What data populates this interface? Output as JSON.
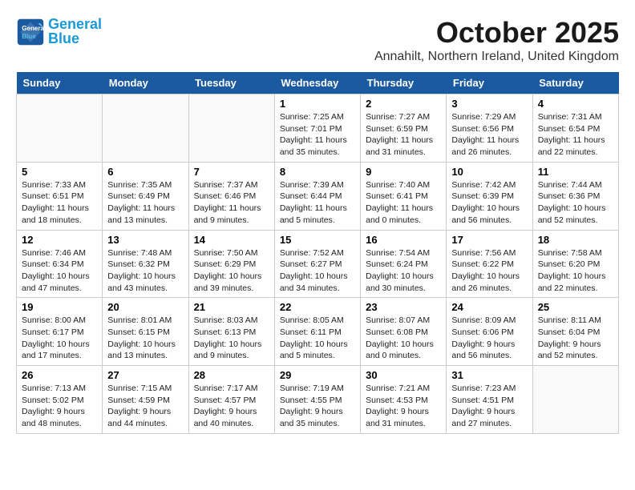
{
  "header": {
    "logo_line1": "General",
    "logo_line2": "Blue",
    "title": "October 2025",
    "subtitle": "Annahilt, Northern Ireland, United Kingdom"
  },
  "days_of_week": [
    "Sunday",
    "Monday",
    "Tuesday",
    "Wednesday",
    "Thursday",
    "Friday",
    "Saturday"
  ],
  "weeks": [
    [
      {
        "date": "",
        "content": ""
      },
      {
        "date": "",
        "content": ""
      },
      {
        "date": "",
        "content": ""
      },
      {
        "date": "1",
        "content": "Sunrise: 7:25 AM\nSunset: 7:01 PM\nDaylight: 11 hours\nand 35 minutes."
      },
      {
        "date": "2",
        "content": "Sunrise: 7:27 AM\nSunset: 6:59 PM\nDaylight: 11 hours\nand 31 minutes."
      },
      {
        "date": "3",
        "content": "Sunrise: 7:29 AM\nSunset: 6:56 PM\nDaylight: 11 hours\nand 26 minutes."
      },
      {
        "date": "4",
        "content": "Sunrise: 7:31 AM\nSunset: 6:54 PM\nDaylight: 11 hours\nand 22 minutes."
      }
    ],
    [
      {
        "date": "5",
        "content": "Sunrise: 7:33 AM\nSunset: 6:51 PM\nDaylight: 11 hours\nand 18 minutes."
      },
      {
        "date": "6",
        "content": "Sunrise: 7:35 AM\nSunset: 6:49 PM\nDaylight: 11 hours\nand 13 minutes."
      },
      {
        "date": "7",
        "content": "Sunrise: 7:37 AM\nSunset: 6:46 PM\nDaylight: 11 hours\nand 9 minutes."
      },
      {
        "date": "8",
        "content": "Sunrise: 7:39 AM\nSunset: 6:44 PM\nDaylight: 11 hours\nand 5 minutes."
      },
      {
        "date": "9",
        "content": "Sunrise: 7:40 AM\nSunset: 6:41 PM\nDaylight: 11 hours\nand 0 minutes."
      },
      {
        "date": "10",
        "content": "Sunrise: 7:42 AM\nSunset: 6:39 PM\nDaylight: 10 hours\nand 56 minutes."
      },
      {
        "date": "11",
        "content": "Sunrise: 7:44 AM\nSunset: 6:36 PM\nDaylight: 10 hours\nand 52 minutes."
      }
    ],
    [
      {
        "date": "12",
        "content": "Sunrise: 7:46 AM\nSunset: 6:34 PM\nDaylight: 10 hours\nand 47 minutes."
      },
      {
        "date": "13",
        "content": "Sunrise: 7:48 AM\nSunset: 6:32 PM\nDaylight: 10 hours\nand 43 minutes."
      },
      {
        "date": "14",
        "content": "Sunrise: 7:50 AM\nSunset: 6:29 PM\nDaylight: 10 hours\nand 39 minutes."
      },
      {
        "date": "15",
        "content": "Sunrise: 7:52 AM\nSunset: 6:27 PM\nDaylight: 10 hours\nand 34 minutes."
      },
      {
        "date": "16",
        "content": "Sunrise: 7:54 AM\nSunset: 6:24 PM\nDaylight: 10 hours\nand 30 minutes."
      },
      {
        "date": "17",
        "content": "Sunrise: 7:56 AM\nSunset: 6:22 PM\nDaylight: 10 hours\nand 26 minutes."
      },
      {
        "date": "18",
        "content": "Sunrise: 7:58 AM\nSunset: 6:20 PM\nDaylight: 10 hours\nand 22 minutes."
      }
    ],
    [
      {
        "date": "19",
        "content": "Sunrise: 8:00 AM\nSunset: 6:17 PM\nDaylight: 10 hours\nand 17 minutes."
      },
      {
        "date": "20",
        "content": "Sunrise: 8:01 AM\nSunset: 6:15 PM\nDaylight: 10 hours\nand 13 minutes."
      },
      {
        "date": "21",
        "content": "Sunrise: 8:03 AM\nSunset: 6:13 PM\nDaylight: 10 hours\nand 9 minutes."
      },
      {
        "date": "22",
        "content": "Sunrise: 8:05 AM\nSunset: 6:11 PM\nDaylight: 10 hours\nand 5 minutes."
      },
      {
        "date": "23",
        "content": "Sunrise: 8:07 AM\nSunset: 6:08 PM\nDaylight: 10 hours\nand 0 minutes."
      },
      {
        "date": "24",
        "content": "Sunrise: 8:09 AM\nSunset: 6:06 PM\nDaylight: 9 hours\nand 56 minutes."
      },
      {
        "date": "25",
        "content": "Sunrise: 8:11 AM\nSunset: 6:04 PM\nDaylight: 9 hours\nand 52 minutes."
      }
    ],
    [
      {
        "date": "26",
        "content": "Sunrise: 7:13 AM\nSunset: 5:02 PM\nDaylight: 9 hours\nand 48 minutes."
      },
      {
        "date": "27",
        "content": "Sunrise: 7:15 AM\nSunset: 4:59 PM\nDaylight: 9 hours\nand 44 minutes."
      },
      {
        "date": "28",
        "content": "Sunrise: 7:17 AM\nSunset: 4:57 PM\nDaylight: 9 hours\nand 40 minutes."
      },
      {
        "date": "29",
        "content": "Sunrise: 7:19 AM\nSunset: 4:55 PM\nDaylight: 9 hours\nand 35 minutes."
      },
      {
        "date": "30",
        "content": "Sunrise: 7:21 AM\nSunset: 4:53 PM\nDaylight: 9 hours\nand 31 minutes."
      },
      {
        "date": "31",
        "content": "Sunrise: 7:23 AM\nSunset: 4:51 PM\nDaylight: 9 hours\nand 27 minutes."
      },
      {
        "date": "",
        "content": ""
      }
    ]
  ]
}
